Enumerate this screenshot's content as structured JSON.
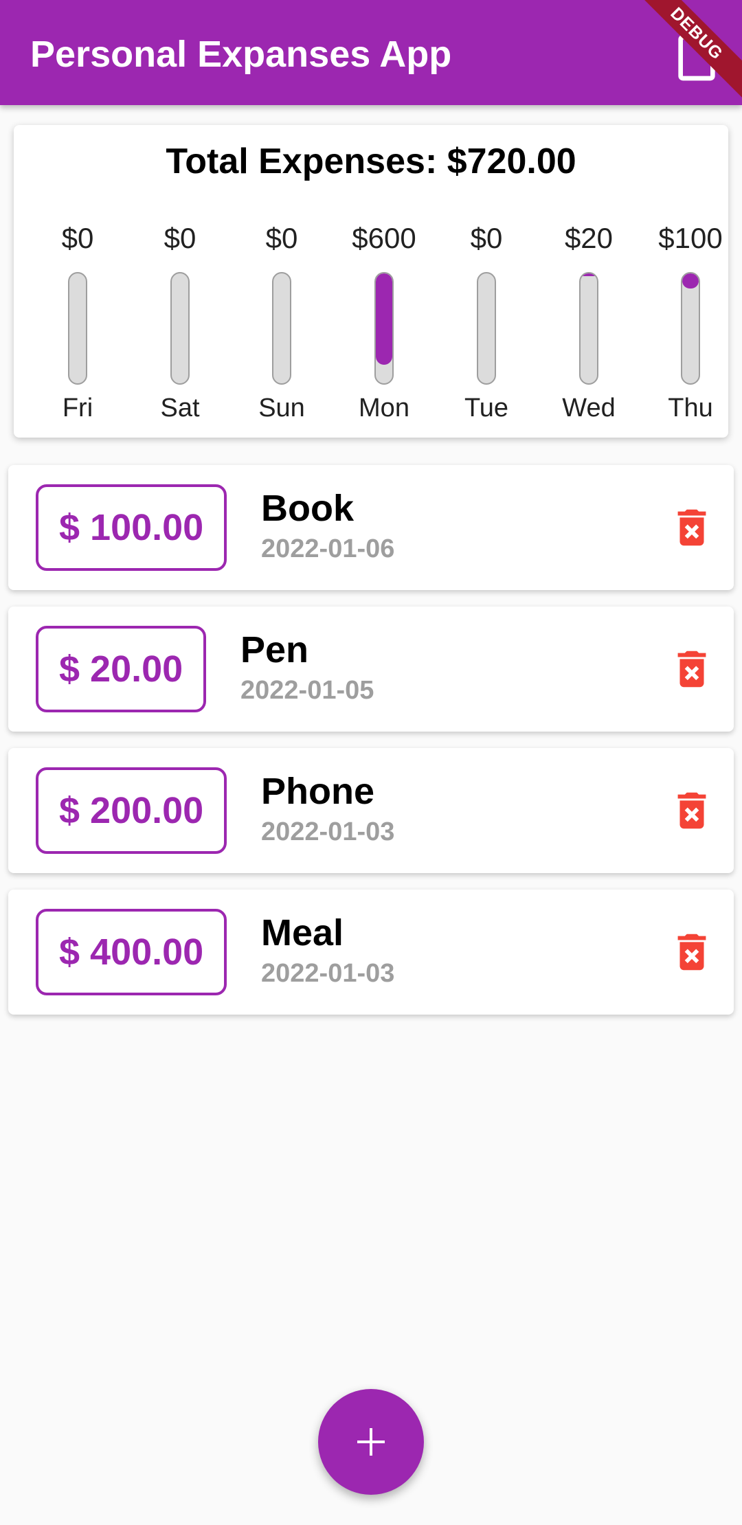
{
  "app": {
    "title": "Personal Expanses App",
    "debug_label": "DEBUG",
    "colors": {
      "primary": "#9c27b0",
      "delete": "#f44336",
      "date_text": "#9e9e9e",
      "track": "#dcdcdc"
    }
  },
  "appbar": {
    "action_icon": "add-document-icon"
  },
  "chart": {
    "total_label": "Total Expenses: $720.00",
    "bars": [
      {
        "day": "Fri",
        "amount": "$0",
        "fraction": 0.0
      },
      {
        "day": "Sat",
        "amount": "$0",
        "fraction": 0.0
      },
      {
        "day": "Sun",
        "amount": "$0",
        "fraction": 0.0
      },
      {
        "day": "Mon",
        "amount": "$600",
        "fraction": 0.8333
      },
      {
        "day": "Tue",
        "amount": "$0",
        "fraction": 0.0
      },
      {
        "day": "Wed",
        "amount": "$20",
        "fraction": 0.0278
      },
      {
        "day": "Thu",
        "amount": "$100",
        "fraction": 0.1389
      }
    ]
  },
  "transactions": [
    {
      "amount": "$ 100.00",
      "title": "Book",
      "date": "2022-01-06",
      "delete_icon": "trash-icon"
    },
    {
      "amount": "$ 20.00",
      "title": "Pen",
      "date": "2022-01-05",
      "delete_icon": "trash-icon"
    },
    {
      "amount": "$ 200.00",
      "title": "Phone",
      "date": "2022-01-03",
      "delete_icon": "trash-icon"
    },
    {
      "amount": "$ 400.00",
      "title": "Meal",
      "date": "2022-01-03",
      "delete_icon": "trash-icon"
    }
  ],
  "fab": {
    "icon": "plus-icon"
  }
}
